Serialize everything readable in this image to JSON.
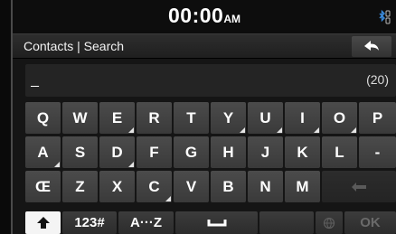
{
  "status": {
    "time": "00:00",
    "ampm": "AM",
    "icons": [
      "bluetooth-icon",
      "phone-icon"
    ]
  },
  "header": {
    "title": "Contacts | Search",
    "back_icon": "back-arrow-icon"
  },
  "input": {
    "value": "_",
    "counter": "(20)"
  },
  "keyboard": {
    "rows": [
      [
        {
          "label": "Q",
          "corner": false
        },
        {
          "label": "W",
          "corner": false
        },
        {
          "label": "E",
          "corner": true
        },
        {
          "label": "R",
          "corner": false
        },
        {
          "label": "T",
          "corner": false
        },
        {
          "label": "Y",
          "corner": true
        },
        {
          "label": "U",
          "corner": true
        },
        {
          "label": "I",
          "corner": true
        },
        {
          "label": "O",
          "corner": true
        },
        {
          "label": "P",
          "corner": false
        }
      ],
      [
        {
          "label": "A",
          "corner": true
        },
        {
          "label": "S",
          "corner": false
        },
        {
          "label": "D",
          "corner": true
        },
        {
          "label": "F",
          "corner": false
        },
        {
          "label": "G",
          "corner": false
        },
        {
          "label": "H",
          "corner": false
        },
        {
          "label": "J",
          "corner": false
        },
        {
          "label": "K",
          "corner": false
        },
        {
          "label": "L",
          "corner": false
        },
        {
          "label": "-",
          "corner": false
        }
      ],
      [
        {
          "label": "Œ",
          "corner": false
        },
        {
          "label": "Z",
          "corner": false
        },
        {
          "label": "X",
          "corner": false
        },
        {
          "label": "C",
          "corner": true
        },
        {
          "label": "V",
          "corner": false
        },
        {
          "label": "B",
          "corner": false
        },
        {
          "label": "N",
          "corner": false
        },
        {
          "label": "M",
          "corner": false
        }
      ]
    ],
    "backspace_icon": "backspace-icon",
    "bottom": {
      "shift_icon": "shift-up-arrow-icon",
      "numbers": "123#",
      "alpha": "A···Z",
      "space_icon": "space-bar-icon",
      "globe_icon": "globe-icon",
      "ok": "OK"
    }
  }
}
